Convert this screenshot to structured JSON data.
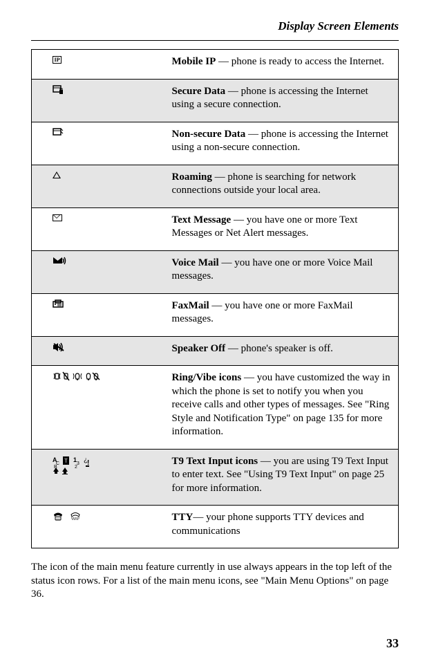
{
  "header": {
    "title": "Display Screen Elements"
  },
  "rows": [
    {
      "icon": "IP-box",
      "title": "Mobile IP",
      "desc": " — phone is ready to access the Internet.",
      "shaded": false
    },
    {
      "icon": "secure-data",
      "title": "Secure Data",
      "desc": " — phone is accessing the Internet using a secure connection.",
      "shaded": true
    },
    {
      "icon": "nonsecure-data",
      "title": "Non-secure Data",
      "desc": " — phone is accessing the Internet using a non-secure connection.",
      "shaded": false
    },
    {
      "icon": "roaming",
      "title": "Roaming",
      "desc": " — phone is searching for network connections outside your local area.",
      "shaded": true
    },
    {
      "icon": "text-message",
      "title": "Text Message",
      "desc": " — you have one or more Text Messages or Net Alert messages.",
      "shaded": false
    },
    {
      "icon": "voice-mail",
      "title": "Voice Mail",
      "desc": " — you have one or more Voice Mail messages.",
      "shaded": true
    },
    {
      "icon": "faxmail",
      "title": "FaxMail",
      "desc": " — you have one or more FaxMail messages.",
      "shaded": false
    },
    {
      "icon": "speaker-off",
      "title": "Speaker Off",
      "desc": " — phone's speaker is off.",
      "shaded": true
    },
    {
      "icon": "ring-vibe",
      "title": "Ring/Vibe icons",
      "desc": " — you have customized the way in which the phone is set to notify you when you receive calls and other types of messages. See \"Ring Style and Notification Type\" on page 135 for more information.",
      "shaded": false
    },
    {
      "icon": "t9-input",
      "title": "T9 Text Input icons",
      "desc": " — you are using T9 Text Input to enter text. See \"Using T9 Text Input\" on page 25 for more information.",
      "shaded": true
    },
    {
      "icon": "tty",
      "title": "TTY",
      "desc": "— your phone supports TTY devices and communications",
      "shaded": false
    }
  ],
  "body_text": "The icon of the main menu feature currently in use always appears in the top left of the status icon rows. For a list of the main menu icons, see \"Main Menu Options\" on page 36.",
  "page_number": "33"
}
